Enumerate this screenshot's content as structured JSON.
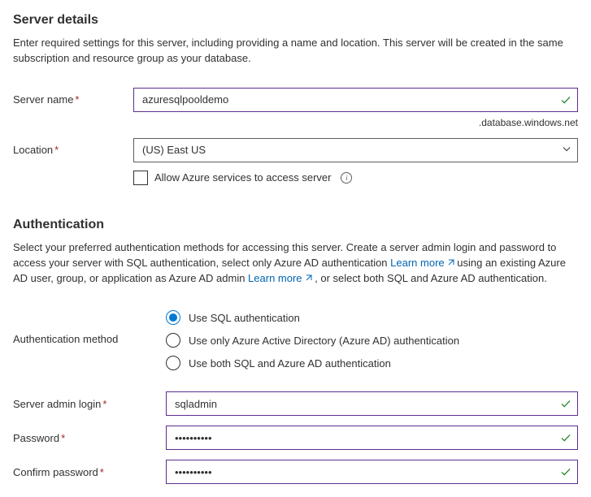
{
  "serverDetails": {
    "title": "Server details",
    "description": "Enter required settings for this server, including providing a name and location. This server will be created in the same subscription and resource group as your database."
  },
  "serverName": {
    "label": "Server name",
    "value": "azuresqlpooldemo",
    "suffix": ".database.windows.net"
  },
  "location": {
    "label": "Location",
    "value": "(US) East US"
  },
  "allowAzure": {
    "label": "Allow Azure services to access server",
    "checked": false
  },
  "auth": {
    "title": "Authentication",
    "descParts": {
      "p1": "Select your preferred authentication methods for accessing this server. Create a server admin login and password to access your server with SQL authentication, select only Azure AD authentication ",
      "link1": "Learn more",
      "p2": " using an existing Azure AD user, group, or application as Azure AD admin ",
      "link2": "Learn more",
      "p3": " , or select both SQL and Azure AD authentication."
    },
    "methodLabel": "Authentication method",
    "options": {
      "sql": "Use SQL authentication",
      "aadOnly": "Use only Azure Active Directory (Azure AD) authentication",
      "both": "Use both SQL and Azure AD authentication"
    },
    "selected": "sql"
  },
  "admin": {
    "loginLabel": "Server admin login",
    "loginValue": "sqladmin",
    "passwordLabel": "Password",
    "passwordValue": "••••••••••",
    "confirmLabel": "Confirm password",
    "confirmValue": "••••••••••"
  }
}
